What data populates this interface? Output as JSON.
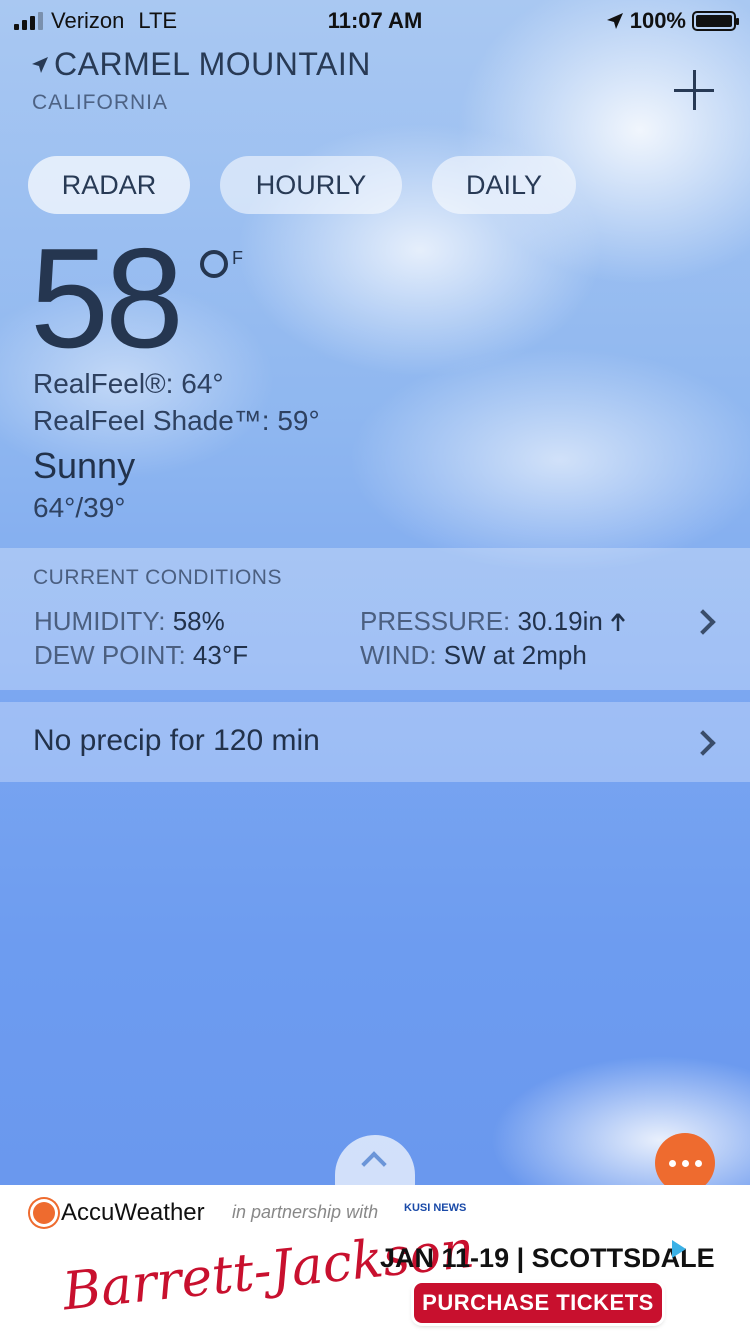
{
  "status_bar": {
    "carrier": "Verizon",
    "network": "LTE",
    "time": "11:07 AM",
    "battery": "100%"
  },
  "location": {
    "city": "CARMEL MOUNTAIN",
    "state": "CALIFORNIA"
  },
  "tabs": {
    "radar": "RADAR",
    "hourly": "HOURLY",
    "daily": "DAILY"
  },
  "current": {
    "temperature": "58",
    "unit": "F",
    "realfeel": "RealFeel®: 64°",
    "realfeel_shade": "RealFeel Shade™: 59°",
    "condition": "Sunny",
    "hi_lo": "64°/39°"
  },
  "conditions": {
    "title": "CURRENT CONDITIONS",
    "humidity_label": "HUMIDITY:",
    "humidity_value": "58%",
    "dew_label": "DEW POINT:",
    "dew_value": "43°F",
    "pressure_label": "PRESSURE:",
    "pressure_value": "30.19in",
    "wind_label": "WIND:",
    "wind_value": "SW at 2mph"
  },
  "precip": {
    "text": "No precip for 120 min"
  },
  "ad": {
    "brand": "AccuWeather",
    "partner_text": "in partnership with",
    "partner_logo": "KUSI NEWS",
    "sponsor": "Barrett-Jackson",
    "dates": "JAN 11-19 | SCOTTSDALE",
    "cta": "PURCHASE TICKETS"
  },
  "colors": {
    "accent_orange": "#ee6b2f",
    "text_dark": "#283a55",
    "ad_red": "#c8102e"
  }
}
